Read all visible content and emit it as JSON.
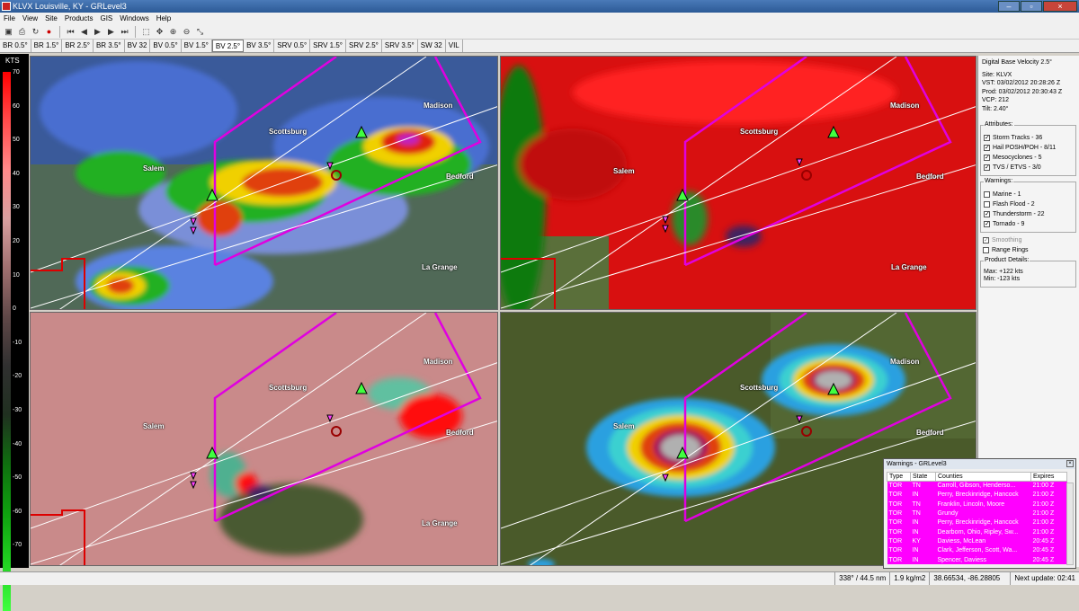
{
  "window": {
    "title": "KLVX Louisville, KY - GRLevel3"
  },
  "menu": [
    "File",
    "View",
    "Site",
    "Products",
    "GIS",
    "Windows",
    "Help"
  ],
  "toolbar_icons": [
    "open-icon",
    "print-icon",
    "reload-icon",
    "record-icon",
    "first-frame-icon",
    "prev-frame-icon",
    "play-icon",
    "next-frame-icon",
    "last-frame-icon",
    "select-icon",
    "pan-icon",
    "zoom-in-icon",
    "zoom-out-icon",
    "measure-icon"
  ],
  "products": [
    "BR 0.5°",
    "BR 1.5°",
    "BR 2.5°",
    "BR 3.5°",
    "BV 32",
    "BV 0.5°",
    "BV 1.5°",
    "BV 2.5°",
    "BV 3.5°",
    "SRV 0.5°",
    "SRV 1.5°",
    "SRV 2.5°",
    "SRV 3.5°",
    "SW 32",
    "VIL"
  ],
  "active_product": "BV 2.5°",
  "legend": {
    "unit": "KTS",
    "ticks": [
      "70",
      "60",
      "50",
      "40",
      "30",
      "20",
      "10",
      "0",
      "-10",
      "-20",
      "-30",
      "-40",
      "-50",
      "-60",
      "-70"
    ],
    "colors": [
      "#ff0000",
      "#ff4b4b",
      "#ff8a8a",
      "#d9a0a0",
      "#a07070",
      "#604848",
      "#303030",
      "#203020",
      "#0f6f0f",
      "#0fa00f",
      "#20d020",
      "#40ff40"
    ]
  },
  "cities": [
    "Madison",
    "Scottsburg",
    "Salem",
    "Bedford",
    "La Grange"
  ],
  "info": {
    "product": "Digital Base Velocity 2.5°",
    "site": "Site:  KLVX",
    "vst": "VST:  03/02/2012   20:28:26 Z",
    "prod": "Prod: 03/02/2012   20:30:43 Z",
    "vcp": "VCP:  212",
    "tilt": "Tilt:   2.40°"
  },
  "attributes": {
    "title": "Attributes:",
    "items": [
      {
        "label": "Storm Tracks - 36",
        "checked": "✓"
      },
      {
        "label": "Hail POSH/POH - 8/11",
        "checked": "✓"
      },
      {
        "label": "Mesocyclones - 5",
        "checked": "✓"
      },
      {
        "label": "TVS / ETVS - 3/0",
        "checked": "✓"
      }
    ]
  },
  "warnings_group": {
    "title": "Warnings:",
    "items": [
      {
        "label": "Marine - 1",
        "checked": ""
      },
      {
        "label": "Flash Flood - 2",
        "checked": ""
      },
      {
        "label": "Thunderstorm - 22",
        "checked": "✓"
      },
      {
        "label": "Tornado - 9",
        "checked": "✓"
      }
    ]
  },
  "options": [
    {
      "label": "Smoothing",
      "checked": "✓"
    },
    {
      "label": "Range Rings",
      "checked": ""
    }
  ],
  "product_details": {
    "title": "Product Details:",
    "max": "Max:      +122 kts",
    "min": "Min:       -123 kts"
  },
  "warnings_window": {
    "title": "Warnings - GRLevel3",
    "columns": [
      "Type",
      "State",
      "Counties",
      "Expires"
    ],
    "rows": [
      [
        "TOR",
        "TN",
        "Carroll, Gibson, Henderso...",
        "21:00 Z"
      ],
      [
        "TOR",
        "IN",
        "Perry, Breckinridge, Hancock",
        "21:00 Z"
      ],
      [
        "TOR",
        "TN",
        "Franklin, Lincoln, Moore",
        "21:00 Z"
      ],
      [
        "TOR",
        "TN",
        "Grundy",
        "21:00 Z"
      ],
      [
        "TOR",
        "IN",
        "Perry, Breckinridge, Hancock",
        "21:00 Z"
      ],
      [
        "TOR",
        "IN",
        "Dearborn, Ohio, Ripley, Sw...",
        "21:00 Z"
      ],
      [
        "TOR",
        "KY",
        "Daviess, McLean",
        "20:45 Z"
      ],
      [
        "TOR",
        "IN",
        "Clark, Jefferson, Scott, Wa...",
        "20:45 Z"
      ],
      [
        "TOR",
        "IN",
        "Spencer, Daviess",
        "20:45 Z"
      ]
    ]
  },
  "status": {
    "bearing": "338° / 44.5 nm",
    "value": "1.9 kg/m2",
    "coords": "38.66534, -86.28805",
    "next_update": "Next update: 02:41"
  },
  "colors": {
    "warning_row": "#ff00ff",
    "polygon": "#d000d0",
    "meso": "#22cc22"
  }
}
